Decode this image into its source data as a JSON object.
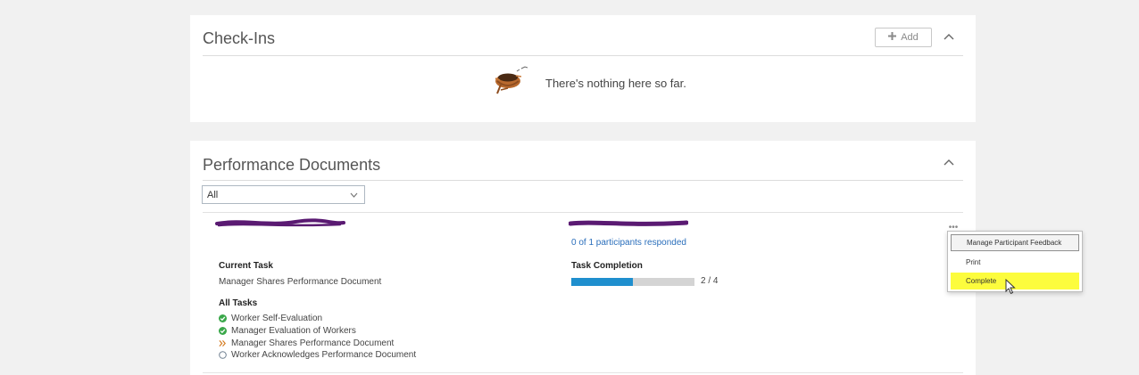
{
  "checkins": {
    "title": "Check-Ins",
    "add_label": "Add",
    "empty_text": "There's nothing here so far."
  },
  "perf": {
    "title": "Performance Documents",
    "filter": {
      "selected": "All"
    },
    "document": {
      "participants": "0 of 1 participants responded",
      "current_task_label": "Current Task",
      "current_task_value": "Manager Shares Performance Document",
      "completion_label": "Task Completion",
      "completion_done": 2,
      "completion_total": 4,
      "completion_text": "2 / 4",
      "all_tasks_label": "All Tasks",
      "tasks": [
        {
          "label": "Worker Self-Evaluation",
          "status": "complete"
        },
        {
          "label": "Manager Evaluation of Workers",
          "status": "complete"
        },
        {
          "label": "Manager Shares Performance Document",
          "status": "current"
        },
        {
          "label": "Worker Acknowledges Performance Document",
          "status": "pending"
        }
      ]
    },
    "more_label": "•••",
    "menu": {
      "items": [
        "Manage Participant Feedback",
        "Print",
        "Complete"
      ]
    }
  },
  "colors": {
    "accent": "#1f8fce",
    "link": "#2a6ebb",
    "check_green": "#3aa84a",
    "current_orange": "#d47a1e",
    "highlight": "#fcfc3d",
    "redaction": "#5a1a72"
  }
}
